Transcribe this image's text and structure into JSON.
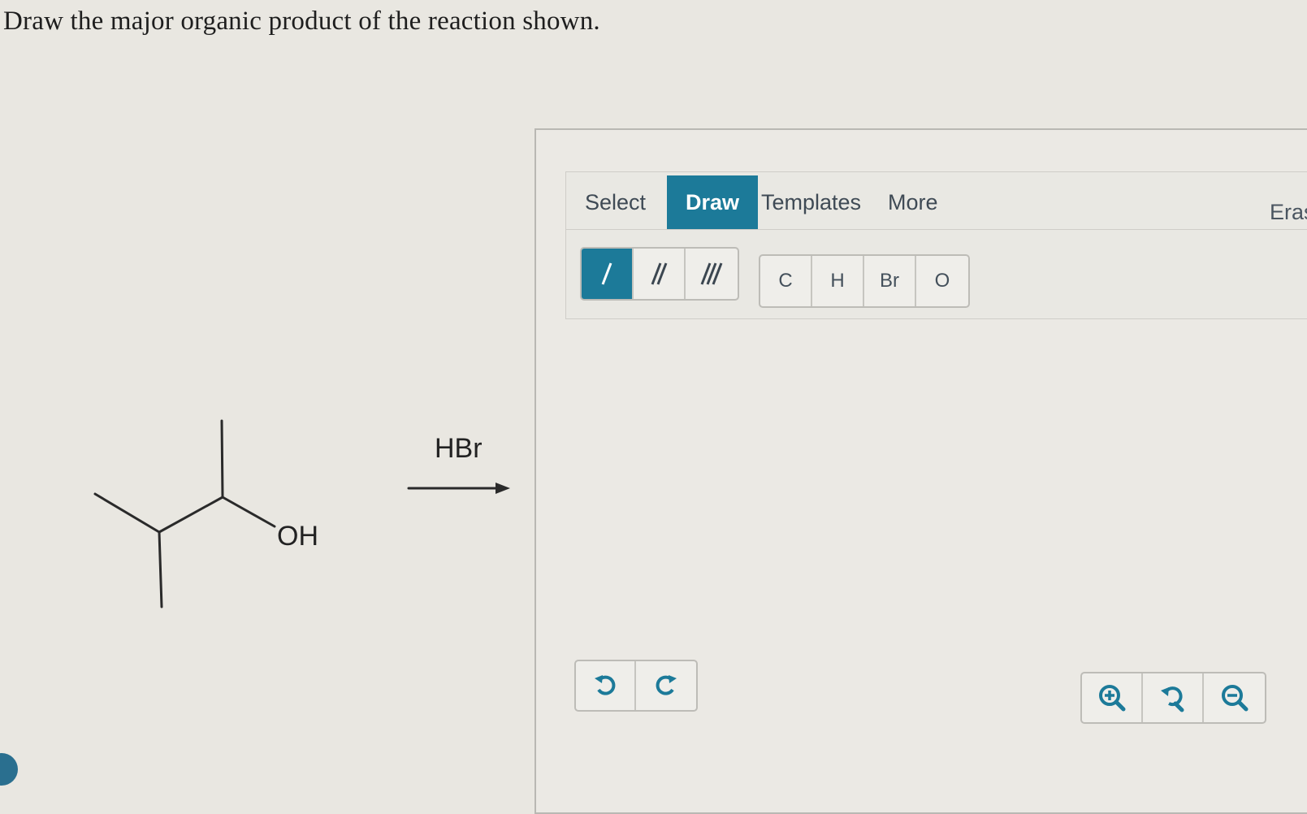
{
  "question": {
    "text": "Draw the major organic product of the reaction shown."
  },
  "reaction": {
    "reagent": "HBr",
    "group_label": "OH"
  },
  "editor": {
    "tabs": [
      "Select",
      "Draw",
      "Templates",
      "More"
    ],
    "active_tab": "Draw",
    "erase_label": "Eras",
    "bond_tools": [
      "single-bond",
      "double-bond",
      "triple-bond"
    ],
    "atoms": [
      "C",
      "H",
      "Br",
      "O"
    ],
    "history_tools": [
      "undo-icon",
      "redo-icon"
    ],
    "zoom_tools": [
      "zoom-in-icon",
      "reset-zoom-icon",
      "zoom-out-icon"
    ]
  },
  "colors": {
    "accent": "#1c7a99",
    "icon": "#1c7a99"
  }
}
